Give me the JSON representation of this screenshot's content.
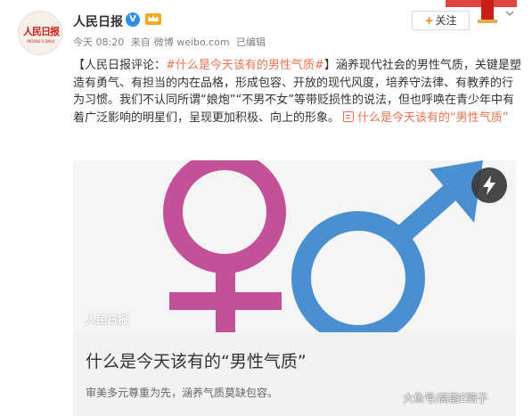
{
  "account": {
    "name": "人民日报",
    "avatar_logo": "人民日报",
    "avatar_sub": "PEOPLE'S DAILY"
  },
  "meta": {
    "time": "今天 08:20",
    "source_prefix": "来自",
    "source": "微博 weibo.com",
    "status": "已编辑"
  },
  "follow": {
    "plus": "+",
    "label": "关注"
  },
  "post": {
    "prefix": "【人民日报评论：",
    "hashtag": "#什么是今天该有的男性气质#",
    "body": "】涵养现代社会的男性气质，关键是塑造有勇气、有担当的内在品格，形成包容、开放的现代风度，培养守法律、有教养的行为习惯。我们不认同所谓“娘炮”“不男不女”等带贬损性的说法，但也呼唤在青少年中有着广泛影响的明星们，呈现更加积极、向上的形象。",
    "link_text": "什么是今天该有的“男性气质”"
  },
  "card": {
    "watermark": "人民日报",
    "title": "什么是今天该有的“男性气质”",
    "description": "审美多元尊重为先，涵养气质莫缺包容。"
  },
  "page_watermark": "大鱼号/高能E陪子",
  "icons": {
    "verified": "verified-badge-icon",
    "crown": "vip-crown-icon",
    "dropdown": "chevron-down-icon",
    "link": "link-icon",
    "lightning": "lightning-icon",
    "female_symbol": "female-symbol-icon",
    "male_symbol": "male-symbol-icon"
  },
  "colors": {
    "link": "#eb7350",
    "follow_plus": "#ff8200",
    "female_symbol": "#c4509a",
    "male_symbol": "#4a8fd0",
    "verified": "#2e8ee8"
  }
}
